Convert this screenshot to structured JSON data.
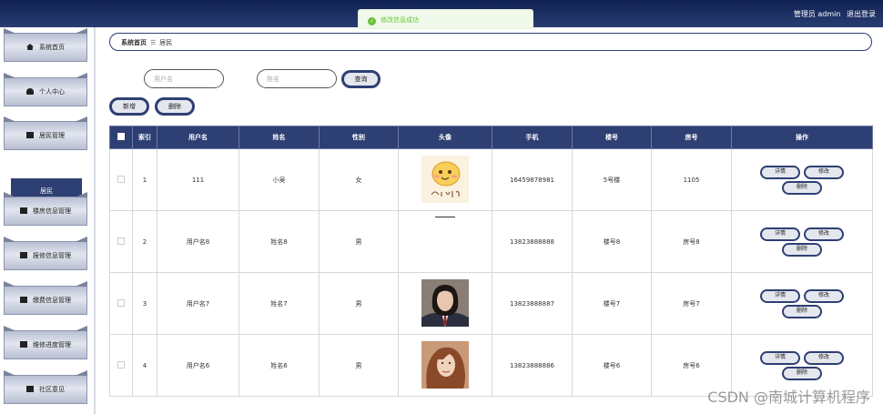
{
  "header": {
    "user": "管理员 admin",
    "logout": "退出登录"
  },
  "toast": {
    "message": "修改信息成功"
  },
  "sidebar": {
    "items": [
      {
        "label": "系统首页"
      },
      {
        "label": "个人中心"
      },
      {
        "label": "居民管理"
      },
      {
        "label": "楼房信息管理"
      },
      {
        "label": "报修信息管理"
      },
      {
        "label": "缴费信息管理"
      },
      {
        "label": "维修进度管理"
      },
      {
        "label": "社区意见"
      }
    ],
    "active_sub": "居民"
  },
  "breadcrumb": {
    "home": "系统首页",
    "separator": "☰",
    "current": "居民"
  },
  "search": {
    "username_placeholder": "用户名",
    "name_placeholder": "姓名",
    "query_label": "查询"
  },
  "actions": {
    "add_label": "新增",
    "delete_label": "删除"
  },
  "table": {
    "columns": [
      "索引",
      "用户名",
      "姓名",
      "性别",
      "头像",
      "手机",
      "楼号",
      "房号",
      "操作"
    ],
    "rows": [
      {
        "index": "1",
        "username": "111",
        "name": "小吴",
        "gender": "女",
        "avatar": "smile-sticker",
        "phone": "16459878981",
        "building": "5号楼",
        "room": "1105"
      },
      {
        "index": "2",
        "username": "用户名8",
        "name": "姓名8",
        "gender": "男",
        "avatar": "none",
        "phone": "13823888888",
        "building": "楼号8",
        "room": "房号8"
      },
      {
        "index": "3",
        "username": "用户名7",
        "name": "姓名7",
        "gender": "男",
        "avatar": "photo-uniform",
        "phone": "13823888887",
        "building": "楼号7",
        "room": "房号7"
      },
      {
        "index": "4",
        "username": "用户名6",
        "name": "姓名6",
        "gender": "男",
        "avatar": "photo-portrait",
        "phone": "13823888886",
        "building": "楼号6",
        "room": "房号6"
      }
    ],
    "op_labels": {
      "detail": "详情",
      "edit": "修改",
      "delete": "删除"
    }
  },
  "watermark": "CSDN @南城计算机程序"
}
